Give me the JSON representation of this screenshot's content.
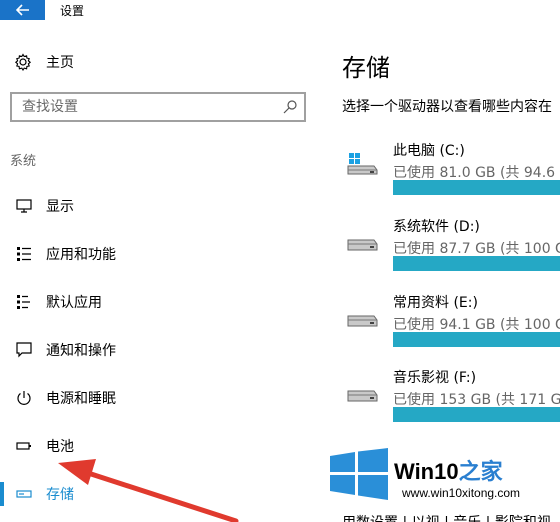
{
  "window": {
    "title": "设置"
  },
  "sidebar": {
    "home_label": "主页",
    "search_placeholder": "查找设置",
    "section_label": "系统",
    "items": [
      {
        "label": "显示",
        "icon": "monitor-icon"
      },
      {
        "label": "应用和功能",
        "icon": "apps-list-icon"
      },
      {
        "label": "默认应用",
        "icon": "default-apps-icon"
      },
      {
        "label": "通知和操作",
        "icon": "notification-icon"
      },
      {
        "label": "电源和睡眠",
        "icon": "power-icon"
      },
      {
        "label": "电池",
        "icon": "battery-icon"
      },
      {
        "label": "存储",
        "icon": "storage-icon",
        "active": true
      }
    ]
  },
  "main": {
    "title": "存储",
    "description": "选择一个驱动器以查看哪些内容在",
    "drives": [
      {
        "name": "此电脑 (C:)",
        "usage": "已使用 81.0 GB (共 94.6",
        "fill": 0.86,
        "icon": "windows-drive-icon"
      },
      {
        "name": "系统软件 (D:)",
        "usage": "已使用 87.7 GB (共 100 G",
        "fill": 0.88,
        "icon": "drive-icon"
      },
      {
        "name": "常用资料 (E:)",
        "usage": "已使用 94.1 GB (共 100 G",
        "fill": 0.94,
        "icon": "drive-icon"
      },
      {
        "name": "音乐影视 (F:)",
        "usage": "已使用 153 GB (共 171 G",
        "fill": 0.89,
        "icon": "drive-icon"
      }
    ],
    "bottom_text": "用数设置 | 以视 | 音乐 | 影院和视"
  },
  "watermark": {
    "brand": "Win10",
    "brand_zh": "之家",
    "url": "www.win10xitong.com"
  },
  "colors": {
    "accent": "#1a8ccf",
    "back_button": "#1a73c8",
    "bar_fill": "#25a8c5",
    "bar_track": "#d6d6d6"
  }
}
